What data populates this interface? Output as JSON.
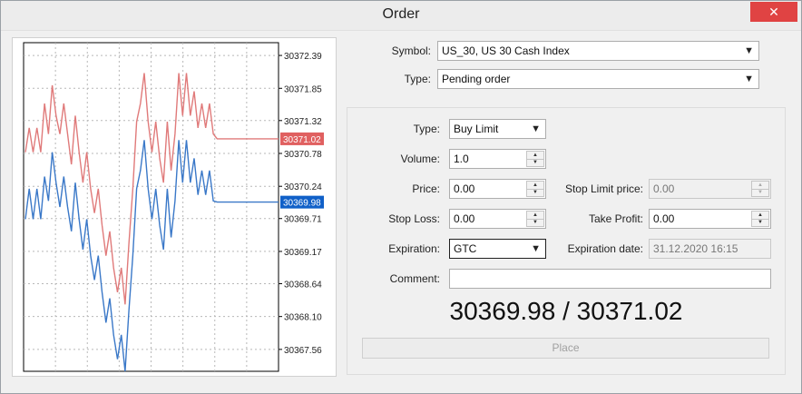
{
  "window": {
    "title": "Order",
    "close_glyph": "✕"
  },
  "chart_data": {
    "type": "line",
    "ylim": [
      30367.2,
      30372.6
    ],
    "y_ticks": [
      "30372.39",
      "30371.85",
      "30371.32",
      "30370.78",
      "30370.24",
      "30369.71",
      "30369.17",
      "30368.64",
      "30368.10",
      "30367.56"
    ],
    "series": [
      {
        "values": [
          30370.8,
          30371.2,
          30370.8,
          30371.2,
          30370.8,
          30371.6,
          30371.1,
          30371.9,
          30371.4,
          30371.1,
          30371.6,
          30371.1,
          30370.6,
          30371.4,
          30370.8,
          30370.3,
          30370.8,
          30370.2,
          30369.8,
          30370.2,
          30369.6,
          30369.1,
          30369.5,
          30368.9,
          30368.5,
          30368.9,
          30368.3,
          30369.3,
          30370.2,
          30371.3,
          30371.6,
          30372.1,
          30371.3,
          30370.8,
          30371.3,
          30370.7,
          30370.3,
          30371.3,
          30370.5,
          30371.1,
          30372.1,
          30371.4,
          30372.1,
          30371.4,
          30371.8,
          30371.2,
          30371.6,
          30371.2,
          30371.6,
          30371.1,
          30371.02,
          30371.02,
          30371.02,
          30371.02,
          30371.02,
          30371.02,
          30371.02,
          30371.02,
          30371.02,
          30371.02,
          30371.02,
          30371.02,
          30371.02,
          30371.02,
          30371.02,
          30371.02,
          30371.02
        ]
      },
      {
        "values": [
          30369.7,
          30370.2,
          30369.7,
          30370.2,
          30369.7,
          30370.4,
          30370.0,
          30370.8,
          30370.3,
          30369.9,
          30370.4,
          30369.9,
          30369.5,
          30370.3,
          30369.7,
          30369.2,
          30369.7,
          30369.1,
          30368.7,
          30369.1,
          30368.5,
          30368.0,
          30368.4,
          30367.8,
          30367.4,
          30367.8,
          30367.2,
          30368.2,
          30369.1,
          30370.2,
          30370.5,
          30371.0,
          30370.2,
          30369.7,
          30370.2,
          30369.6,
          30369.2,
          30370.2,
          30369.4,
          30370.0,
          30371.0,
          30370.3,
          30371.0,
          30370.3,
          30370.7,
          30370.1,
          30370.5,
          30370.1,
          30370.5,
          30370.0,
          30369.98,
          30369.98,
          30369.98,
          30369.98,
          30369.98,
          30369.98,
          30369.98,
          30369.98,
          30369.98,
          30369.98,
          30369.98,
          30369.98,
          30369.98,
          30369.98,
          30369.98,
          30369.98,
          30369.98
        ]
      }
    ],
    "ask_label": "30371.02",
    "bid_label": "30369.98",
    "colors": {
      "ask": "#e07a7a",
      "bid": "#3a78c8",
      "ask_badge": "#e06060",
      "bid_badge": "#1060c8"
    }
  },
  "form": {
    "symbol_label": "Symbol:",
    "symbol_value": "US_30, US 30 Cash Index",
    "type_label": "Type:",
    "type_value": "Pending order",
    "order_type_label": "Type:",
    "order_type_value": "Buy Limit",
    "volume_label": "Volume:",
    "volume_value": "1.0",
    "price_label": "Price:",
    "price_value": "0.00",
    "stop_limit_label": "Stop Limit price:",
    "stop_limit_value": "0.00",
    "stop_loss_label": "Stop Loss:",
    "stop_loss_value": "0.00",
    "take_profit_label": "Take Profit:",
    "take_profit_value": "0.00",
    "expiration_label": "Expiration:",
    "expiration_value": "GTC",
    "expiration_date_label": "Expiration date:",
    "expiration_date_value": "31.12.2020 16:15",
    "comment_label": "Comment:",
    "comment_value": ""
  },
  "quote": {
    "bid": "30369.98",
    "separator": " / ",
    "ask": "30371.02"
  },
  "buttons": {
    "place_label": "Place"
  },
  "icons": {
    "dropdown": "▼",
    "spin_up": "▲",
    "spin_down": "▼"
  }
}
